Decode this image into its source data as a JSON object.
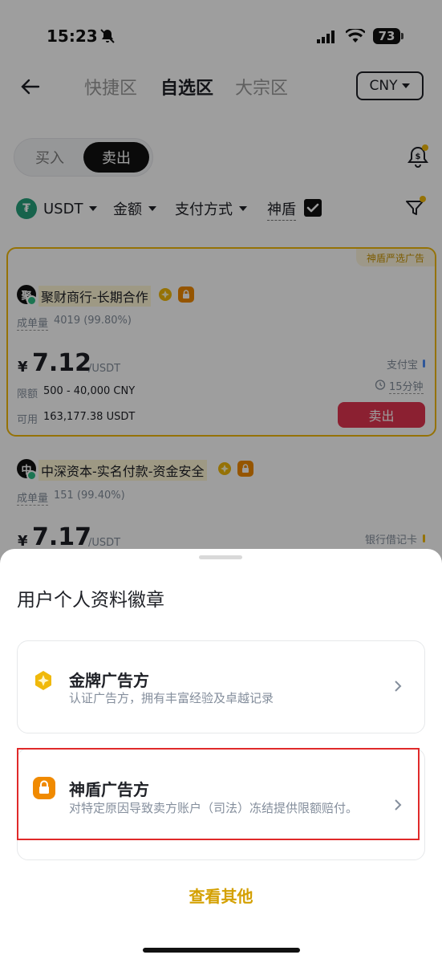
{
  "status_bar": {
    "time": "15:23",
    "battery": "73"
  },
  "header": {
    "tabs": [
      "快捷区",
      "自选区",
      "大宗区"
    ],
    "active_tab": "自选区",
    "currency": "CNY"
  },
  "trade_toggle": {
    "buy": "买入",
    "sell": "卖出",
    "selected": "卖出"
  },
  "filters": {
    "asset": "USDT",
    "amount": "金额",
    "payment": "支付方式",
    "shield": "神盾",
    "shield_checked": true
  },
  "ads": [
    {
      "tag": "神盾严选广告",
      "avatar": "聚",
      "merchant": "聚财商行-长期合作",
      "volume_label": "成单量",
      "volume": "4019 (99.80%)",
      "currency_symbol": "¥",
      "price": "7.12",
      "unit": "/USDT",
      "limit_label": "限额",
      "limit": "500 - 40,000 CNY",
      "available_label": "可用",
      "available": "163,177.38 USDT",
      "payment": "支付宝",
      "time_limit": "15分钟",
      "action": "卖出"
    },
    {
      "avatar": "中",
      "merchant": "中深资本-实名付款-资金安全",
      "volume_label": "成单量",
      "volume": "151 (99.40%)",
      "currency_symbol": "¥",
      "price": "7.17",
      "unit": "/USDT",
      "payment": "银行借记卡"
    }
  ],
  "sheet": {
    "title": "用户个人资料徽章",
    "options": [
      {
        "icon": "gold-medal-icon",
        "title": "金牌广告方",
        "desc": "认证广告方，拥有丰富经验及卓越记录"
      },
      {
        "icon": "shield-lock-icon",
        "title": "神盾广告方",
        "desc": "对特定原因导致卖方账户（司法）冻结提供限额赔付。"
      }
    ],
    "more": "查看其他"
  },
  "colors": {
    "brand_yellow": "#f0b90b",
    "sell_red": "#e0354f",
    "highlight_red": "#e02a2a",
    "usdt_green": "#26a17b"
  }
}
